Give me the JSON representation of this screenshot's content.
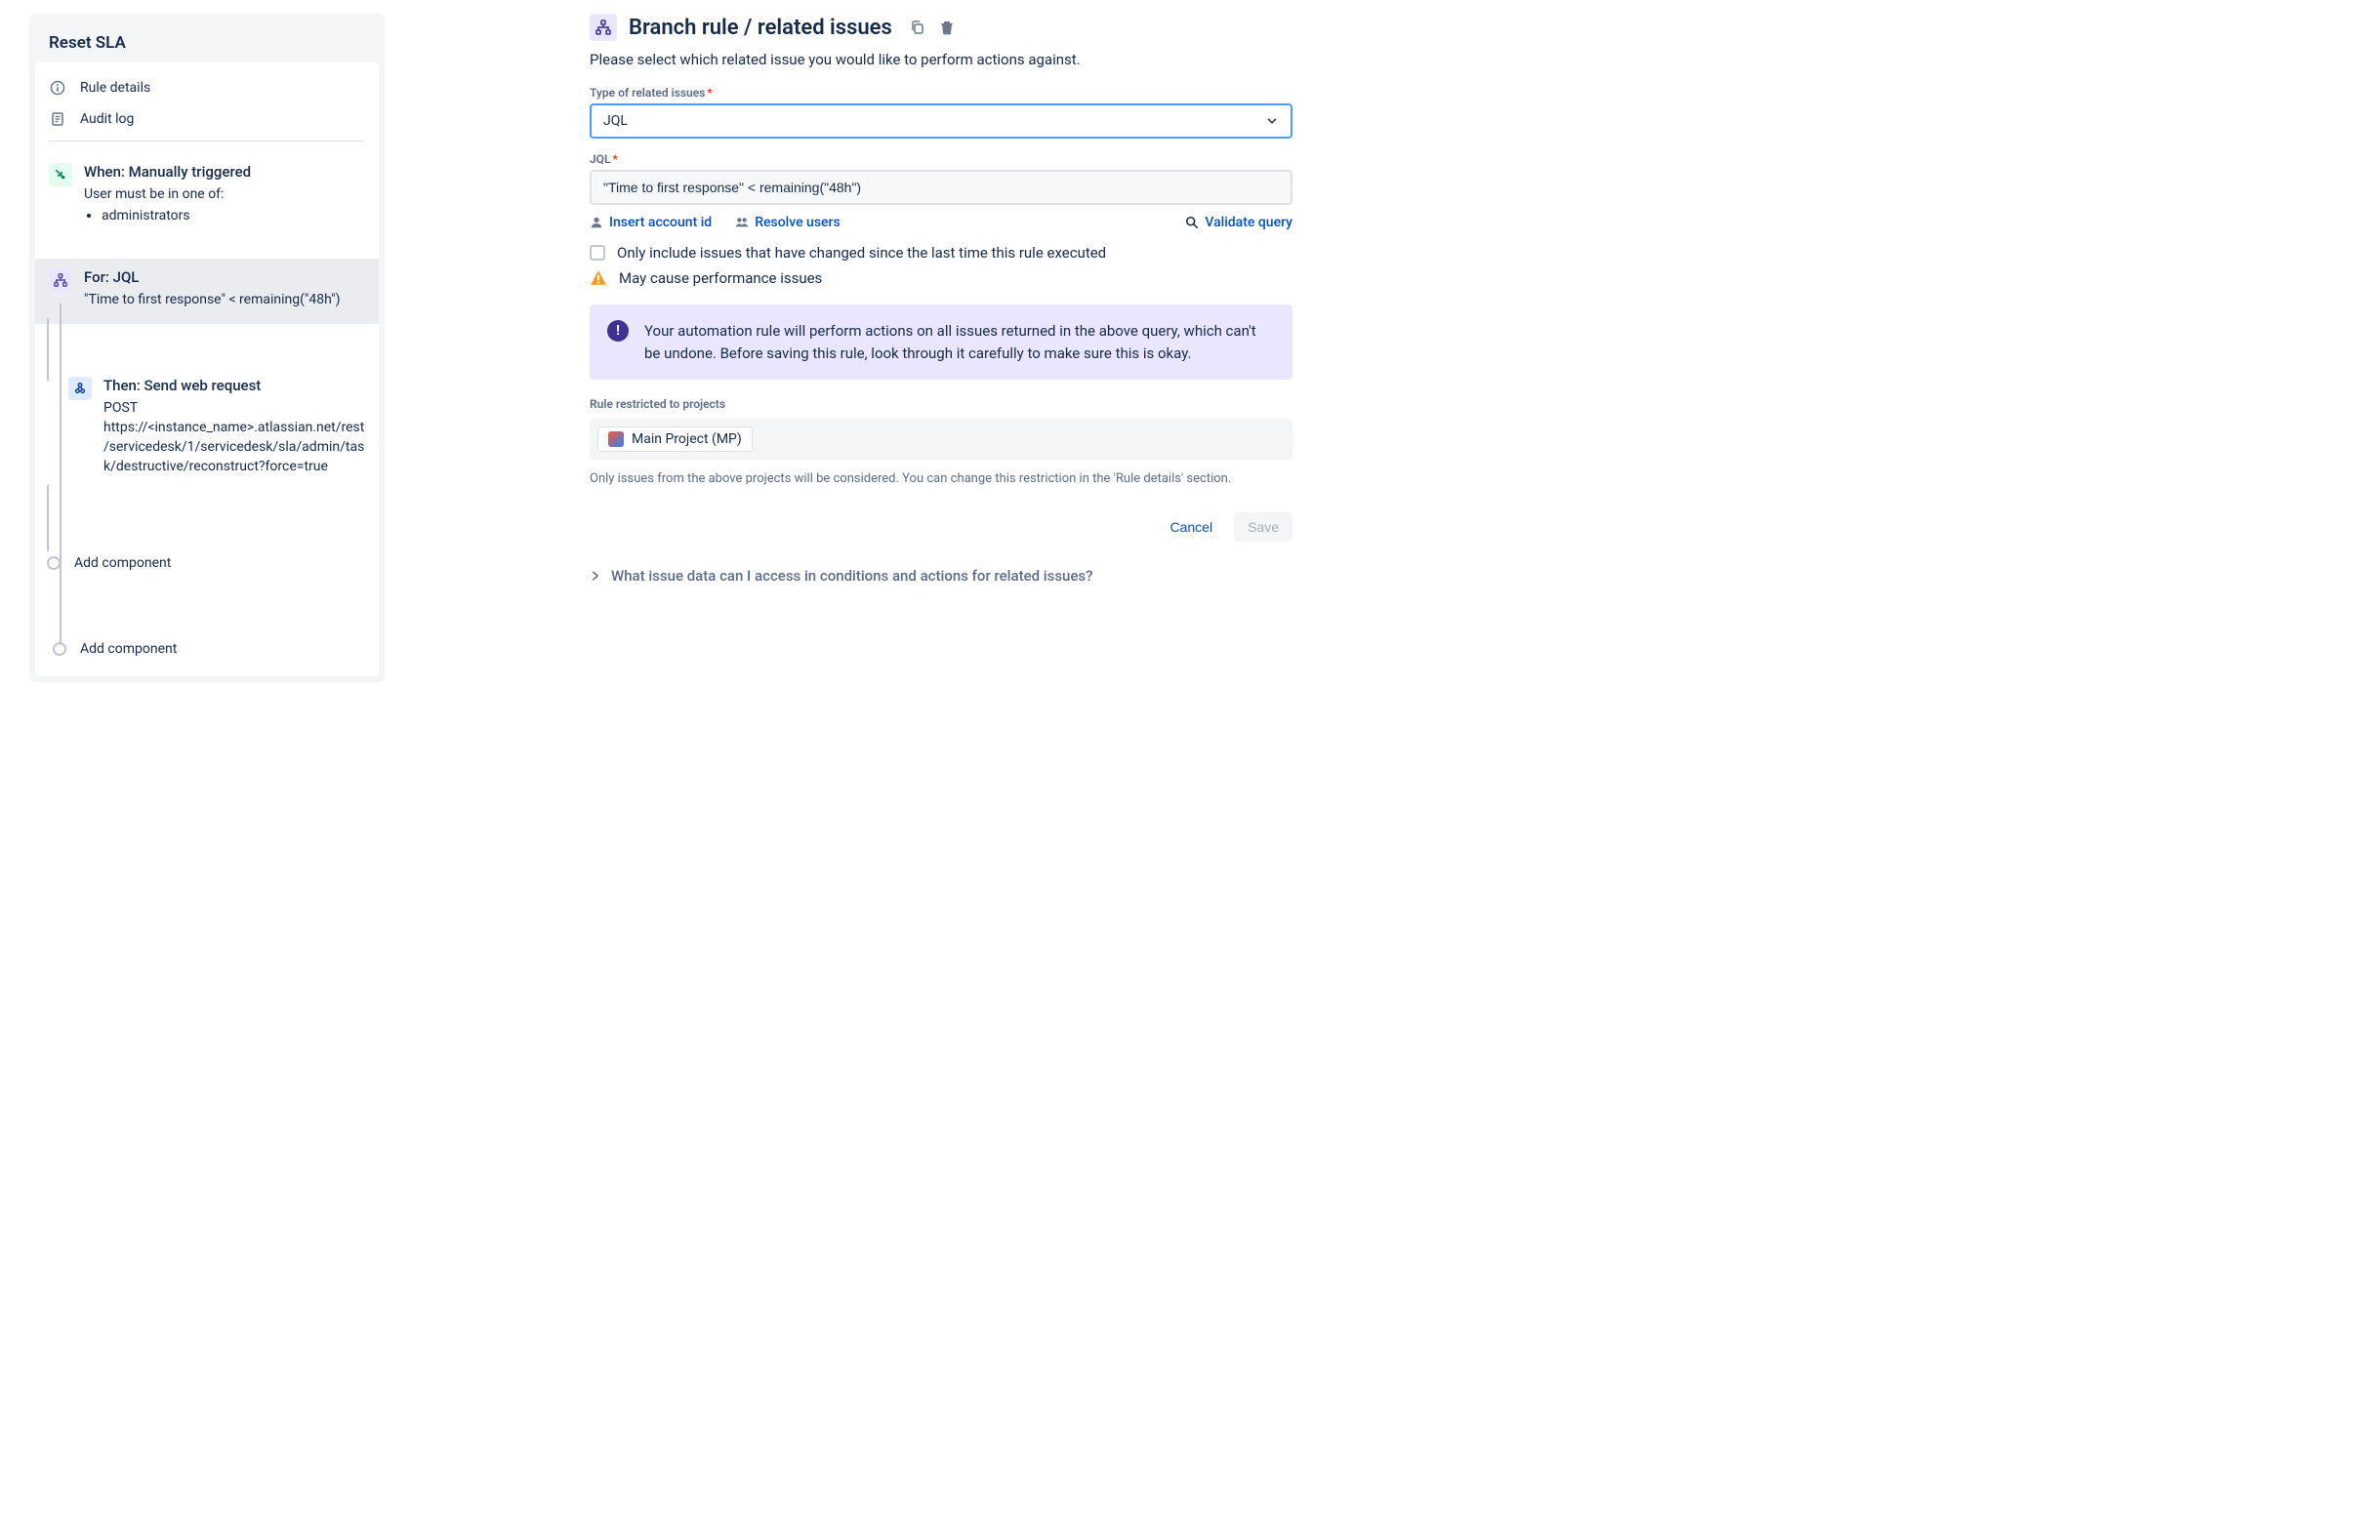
{
  "sidebar": {
    "rule_name": "Reset SLA",
    "tabs": {
      "details": "Rule details",
      "audit": "Audit log"
    },
    "trigger": {
      "title": "When: Manually triggered",
      "desc": "User must be in one of:",
      "role": "administrators"
    },
    "branch": {
      "title": "For: JQL",
      "desc": "\"Time to first response\" < remaining(\"48h\")"
    },
    "action": {
      "title": "Then: Send web request",
      "desc": "POST https://<instance_name>.atlassian.net/rest/servicedesk/1/servicedesk/sla/admin/task/destructive/reconstruct?force=true"
    },
    "add_component": "Add component"
  },
  "main": {
    "title": "Branch rule / related issues",
    "subtitle": "Please select which related issue you would like to perform actions against.",
    "type_label": "Type of related issues",
    "type_value": "JQL",
    "jql_label": "JQL",
    "jql_value": "\"Time to first response\" < remaining(\"48h\")",
    "links": {
      "insert_account": "Insert account id",
      "resolve_users": "Resolve users",
      "validate": "Validate query"
    },
    "only_changed": "Only include issues that have changed since the last time this rule executed",
    "perf_warning": "May cause performance issues",
    "info": "Your automation rule will perform actions on all issues returned in the above query, which can't be undone. Before saving this rule, look through it carefully to make sure this is okay.",
    "restricted_label": "Rule restricted to projects",
    "project_chip": "Main Project (MP)",
    "restricted_helper": "Only issues from the above projects will be considered. You can change this restriction in the 'Rule details' section.",
    "buttons": {
      "cancel": "Cancel",
      "save": "Save"
    },
    "expander": "What issue data can I access in conditions and actions for related issues?"
  }
}
